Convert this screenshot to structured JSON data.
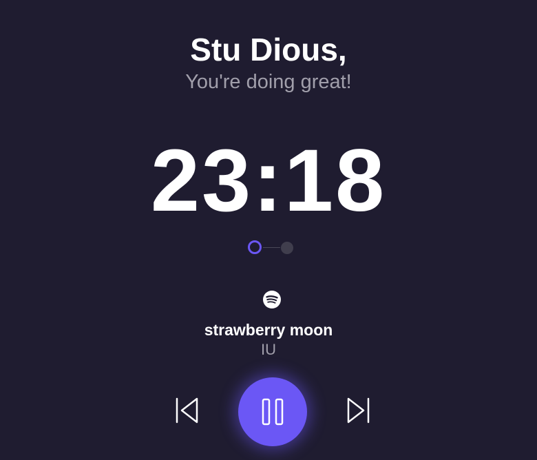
{
  "greeting": {
    "name": "Stu Dious,",
    "message": "You're doing great!"
  },
  "timer": {
    "display": "23:18"
  },
  "session_progress": {
    "total_steps": 2,
    "current_step": 1
  },
  "now_playing": {
    "service_icon": "spotify-icon",
    "title": "strawberry moon",
    "artist": "IU"
  },
  "controls": {
    "previous_icon": "skip-previous-icon",
    "pause_icon": "pause-icon",
    "next_icon": "skip-next-icon"
  },
  "colors": {
    "background": "#1f1c30",
    "accent": "#6b57f5",
    "muted_text": "#a19fab"
  }
}
